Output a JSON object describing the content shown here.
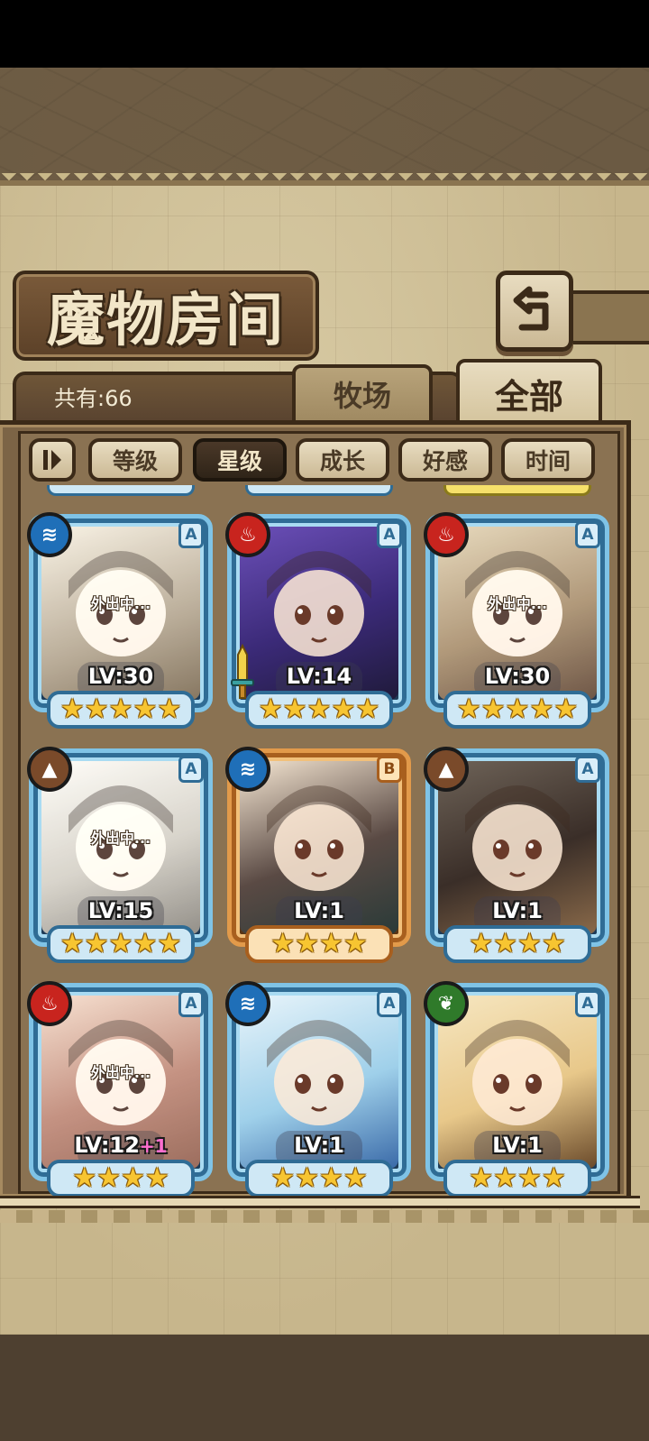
{
  "title": "魔物房间",
  "total_label": "共有:66",
  "tabs": [
    {
      "label": "牧场",
      "active": false
    },
    {
      "label": "全部",
      "active": true
    }
  ],
  "sort_buttons": [
    {
      "label": "等级",
      "active": false
    },
    {
      "label": "星级",
      "active": true
    },
    {
      "label": "成长",
      "active": false
    },
    {
      "label": "好感",
      "active": false
    },
    {
      "label": "时间",
      "active": false
    }
  ],
  "away_label": "外出中...",
  "monsters": [
    {
      "element": "water",
      "rank": "A",
      "level": "LV:30",
      "bonus": "",
      "stars": 5,
      "away": true,
      "frame": "blue"
    },
    {
      "element": "fire",
      "rank": "A",
      "level": "LV:14",
      "bonus": "",
      "stars": 5,
      "away": false,
      "frame": "blue",
      "equipped": "sword-icon"
    },
    {
      "element": "fire",
      "rank": "A",
      "level": "LV:30",
      "bonus": "",
      "stars": 5,
      "away": true,
      "frame": "blue"
    },
    {
      "element": "earth",
      "rank": "A",
      "level": "LV:15",
      "bonus": "",
      "stars": 5,
      "away": true,
      "frame": "blue"
    },
    {
      "element": "water",
      "rank": "B",
      "level": "LV:1",
      "bonus": "",
      "stars": 4,
      "away": false,
      "frame": "bronze"
    },
    {
      "element": "earth",
      "rank": "A",
      "level": "LV:1",
      "bonus": "",
      "stars": 4,
      "away": false,
      "frame": "blue"
    },
    {
      "element": "fire",
      "rank": "A",
      "level": "LV:12",
      "bonus": "+1",
      "stars": 4,
      "away": true,
      "frame": "blue"
    },
    {
      "element": "water",
      "rank": "A",
      "level": "LV:1",
      "bonus": "",
      "stars": 4,
      "away": false,
      "frame": "blue"
    },
    {
      "element": "wood",
      "rank": "A",
      "level": "LV:1",
      "bonus": "",
      "stars": 4,
      "away": false,
      "frame": "blue"
    }
  ],
  "colors": {
    "fire": "#c8241e",
    "water": "#1f6fb8",
    "earth": "#7a4a2a",
    "wood": "#2f7a2a"
  }
}
